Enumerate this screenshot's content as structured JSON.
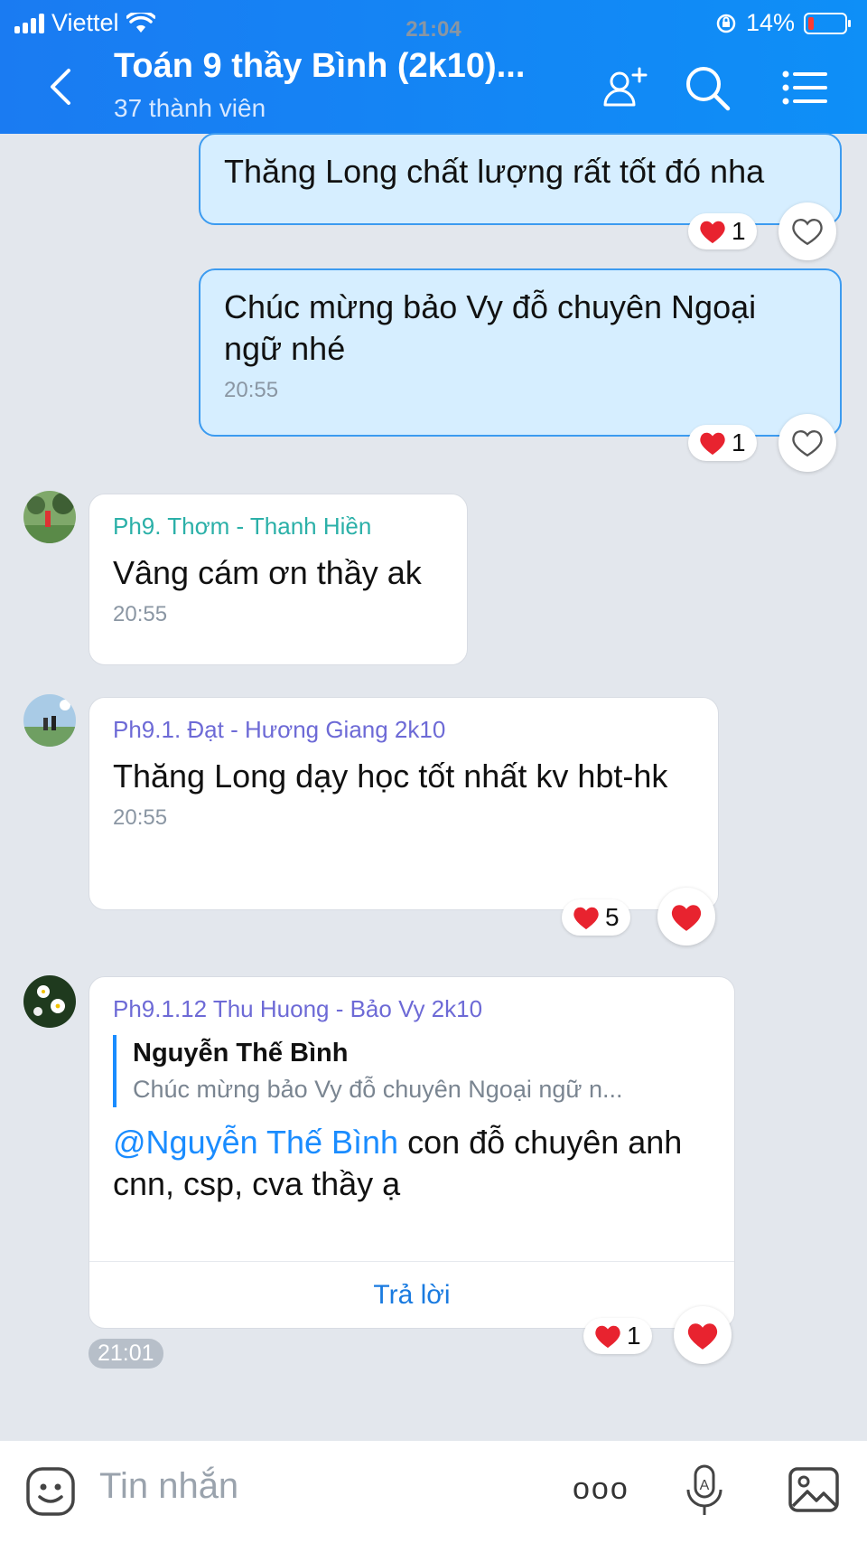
{
  "status": {
    "carrier": "Viettel",
    "time": "21:04",
    "battery": "14%"
  },
  "header": {
    "title": "Toán 9 thầy Bình (2k10)...",
    "subtitle": "37 thành viên"
  },
  "messages": [
    {
      "text": "Thăng Long chất lượng rất tốt đó nha",
      "reaction_count": "1"
    },
    {
      "text": "Chúc mừng bảo Vy đỗ chuyên Ngoại ngữ nhé",
      "time": "20:55",
      "reaction_count": "1"
    },
    {
      "sender": "Ph9. Thơm - Thanh Hiền",
      "text": "Vâng cám ơn thầy ak",
      "time": "20:55"
    },
    {
      "sender": "Ph9.1. Đạt - Hương Giang 2k10",
      "text": "Thăng Long dạy học tốt nhất kv hbt-hk",
      "time": "20:55",
      "reaction_count": "5"
    },
    {
      "sender": "Ph9.1.12 Thu Huong - Bảo Vy 2k10",
      "quote_name": "Nguyễn Thế Bình",
      "quote_text": "Chúc mừng bảo Vy đỗ chuyên Ngoại ngữ n...",
      "mention": "@Nguyễn Thế Bình",
      "text": " con đỗ chuyên anh cnn, csp, cva thầy ạ",
      "reply_label": "Trả lời",
      "reaction_count": "1",
      "time": "21:01"
    }
  ],
  "input": {
    "placeholder": "Tin nhắn",
    "more": "ooo"
  },
  "colors": {
    "header": "#1a7bf2",
    "my_bubble": "#d6eeff",
    "heart": "#e8232f",
    "sender1": "#2bb0a8",
    "sender2": "#6d6ad6",
    "link": "#1a8cff"
  }
}
